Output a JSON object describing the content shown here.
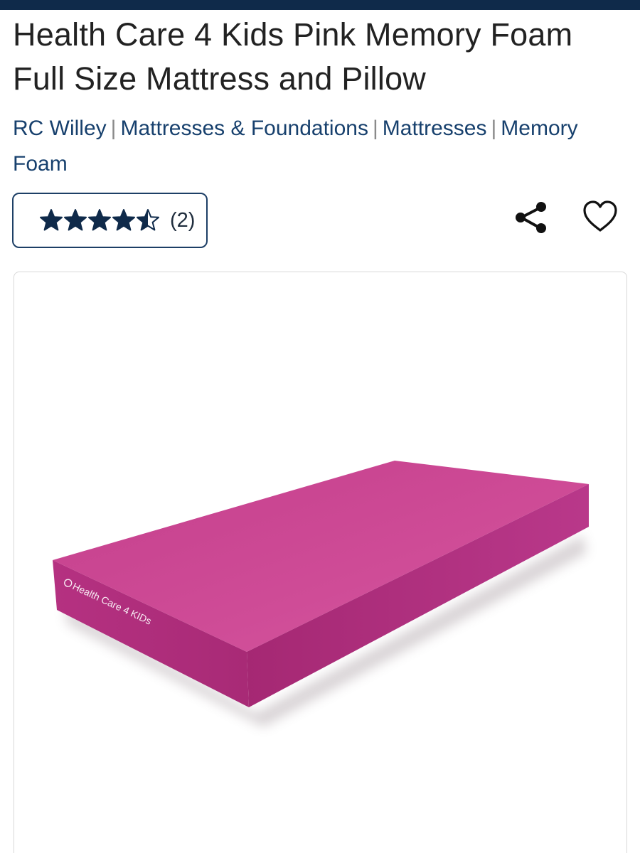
{
  "product": {
    "title": "Health Care 4 Kids Pink Memory Foam Full Size Mattress and Pillow"
  },
  "breadcrumb": [
    {
      "label": "RC Willey"
    },
    {
      "label": "Mattresses & Foundations"
    },
    {
      "label": "Mattresses"
    },
    {
      "label": "Memory Foam"
    }
  ],
  "breadcrumb_separator": "|",
  "rating": {
    "stars": 4.5,
    "max": 5,
    "count_label": "(2)",
    "star_color": "#0f2a4a"
  },
  "actions": {
    "share_icon": "share-icon",
    "favorite_icon": "heart-icon"
  },
  "image": {
    "brand_mark": "Health Care 4 KIDs",
    "mattress_color": "#c7418f"
  },
  "colors": {
    "top_bar": "#0f2a4a",
    "link": "#17406d"
  }
}
